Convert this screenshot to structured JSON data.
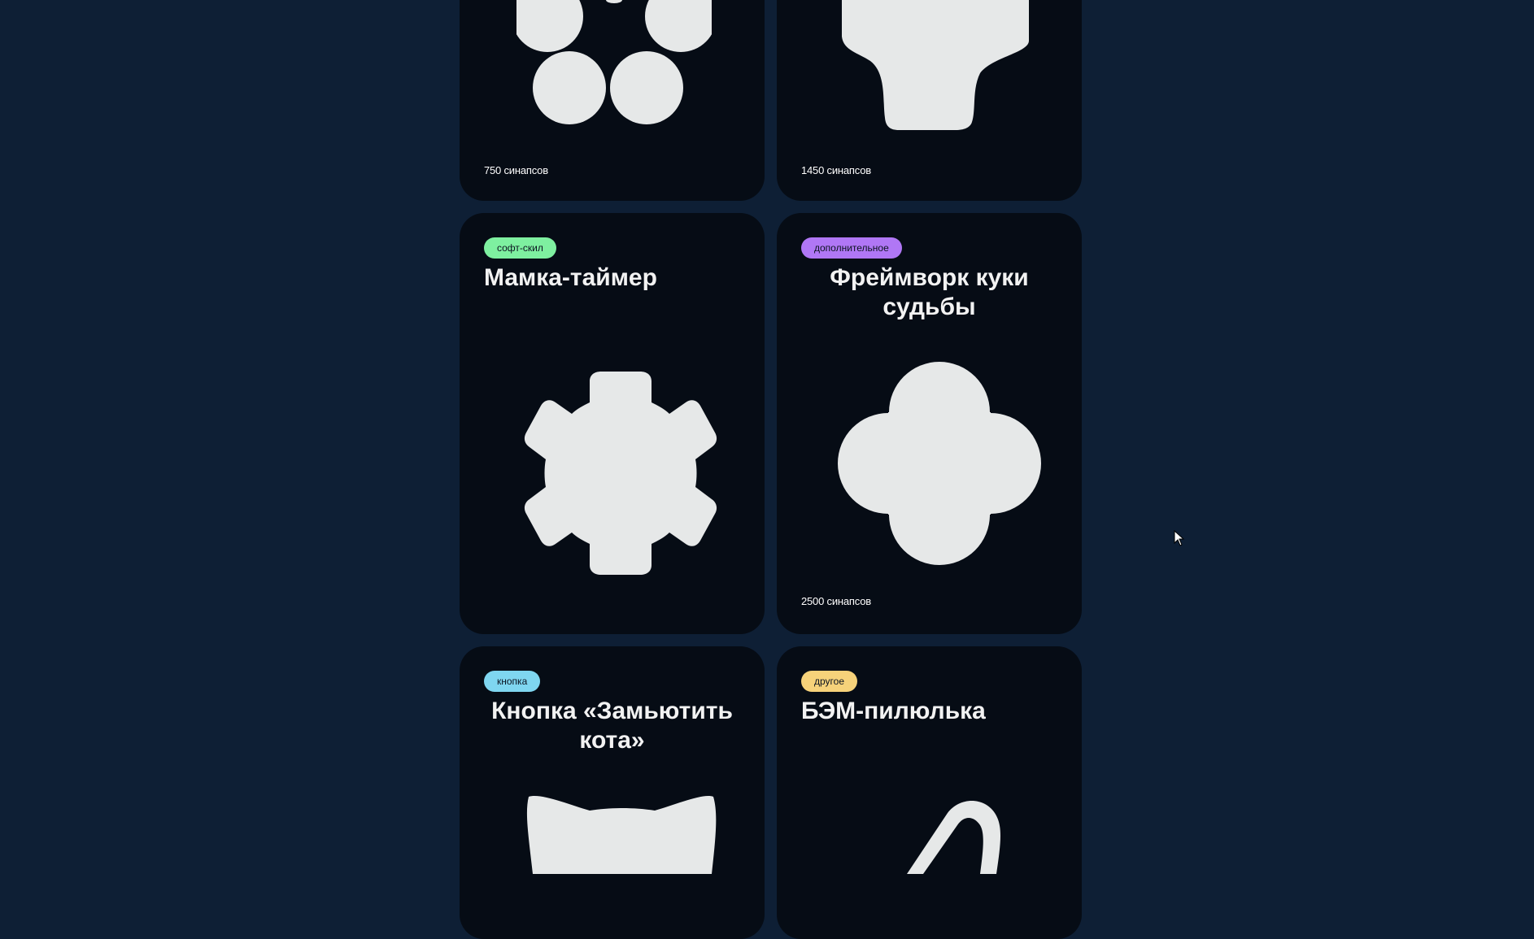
{
  "cards": [
    {
      "id": "card-1",
      "count": "750 синапсов",
      "shape": "circles-icon"
    },
    {
      "id": "card-2",
      "count": "1450 синапсов",
      "shape": "mushroom-icon"
    },
    {
      "id": "card-3",
      "badge": "софт-скил",
      "badge_color": "#7ef0a0",
      "title": "Мамка-таймер",
      "shape": "gear-icon"
    },
    {
      "id": "card-4",
      "badge": "дополнительное",
      "badge_color": "#b077f5",
      "title": "Фреймворк куки судьбы",
      "count": "2500 синапсов",
      "shape": "clover-icon"
    },
    {
      "id": "card-5",
      "badge": "кнопка",
      "badge_color": "#7fd6f0",
      "title": "Кнопка «Замьютить кота»",
      "shape": "cat-icon"
    },
    {
      "id": "card-6",
      "badge": "другое",
      "badge_color": "#f6d27a",
      "title": "БЭМ-пилюлька",
      "shape": "pill-icon"
    }
  ],
  "colors": {
    "page_background": "#0e1f35",
    "card_background": "#060c15",
    "shape_fill": "#e6e8e8"
  }
}
